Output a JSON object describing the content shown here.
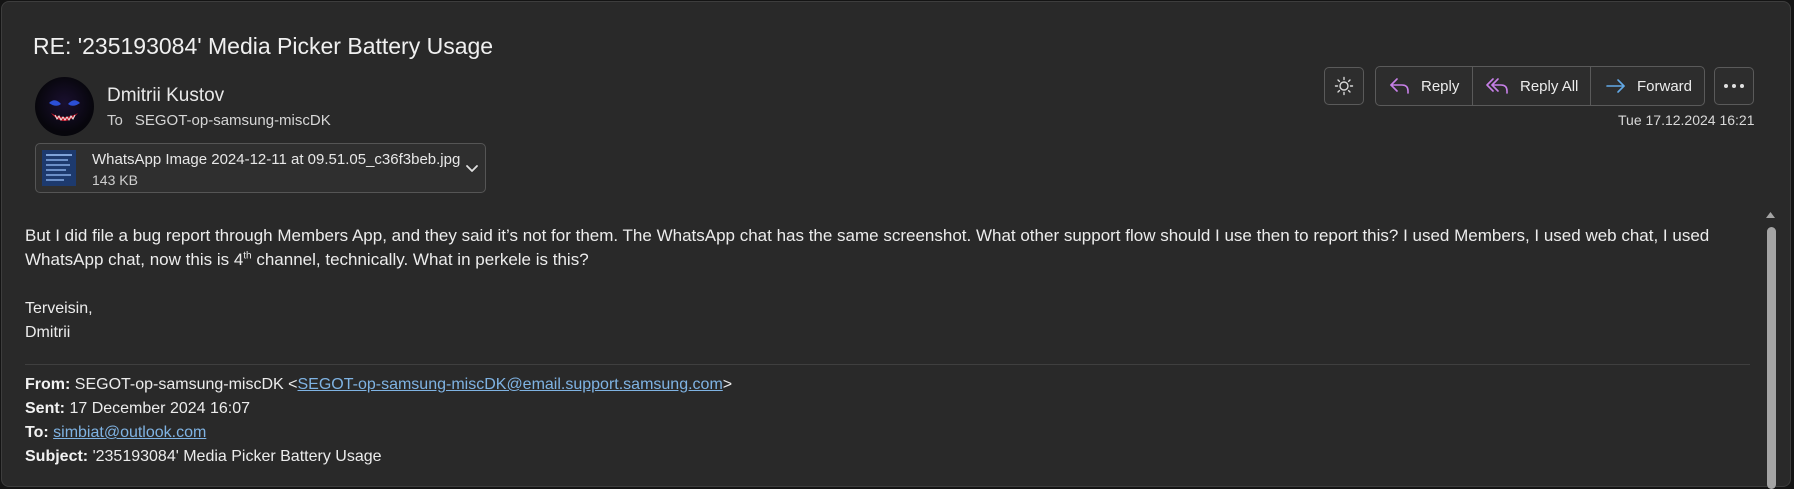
{
  "email": {
    "subject": "RE: '235193084' Media Picker Battery Usage",
    "sender_name": "Dmitrii Kustov",
    "to_label": "To",
    "to_value": "SEGOT-op-samsung-miscDK",
    "date": "Tue 17.12.2024 16:21"
  },
  "attachment": {
    "name": "WhatsApp Image 2024-12-11 at 09.51.05_c36f3beb.jpg",
    "size": "143 KB"
  },
  "toolbar": {
    "reply_label": "Reply",
    "reply_all_label": "Reply All",
    "forward_label": "Forward"
  },
  "body": {
    "para1_part1": "But I did file a bug report through Members App, and they said it’s not for them. The WhatsApp chat has the same screenshot. What other support flow should I use then to report this? I used Members, I used web chat, I used WhatsApp chat, now this is 4",
    "para1_sup": "th",
    "para1_part2": " channel, technically. What in perkele is this?",
    "closing": "Terveisin,",
    "signature": "Dmitrii"
  },
  "quoted": {
    "from_label": "From:",
    "from_name": " SEGOT-op-samsung-miscDK <",
    "from_email": "SEGOT-op-samsung-miscDK@email.support.samsung.com",
    "from_close": ">",
    "sent_label": "Sent:",
    "sent_value": " 17 December 2024 16:07",
    "to_label": "To:",
    "to_email": "simbiat@outlook.com",
    "subject_label": "Subject:",
    "subject_value": " '235193084' Media Picker Battery Usage"
  },
  "icons": {
    "theme": "sun-icon",
    "reply": "reply-arrow-icon",
    "reply_all": "reply-all-arrow-icon",
    "forward": "forward-arrow-icon",
    "more": "ellipsis-icon",
    "attachment_menu": "chevron-down-icon"
  },
  "colors": {
    "reply_icon": "#c780e8",
    "forward_icon": "#63a9e6",
    "link": "#7fb3e3"
  }
}
